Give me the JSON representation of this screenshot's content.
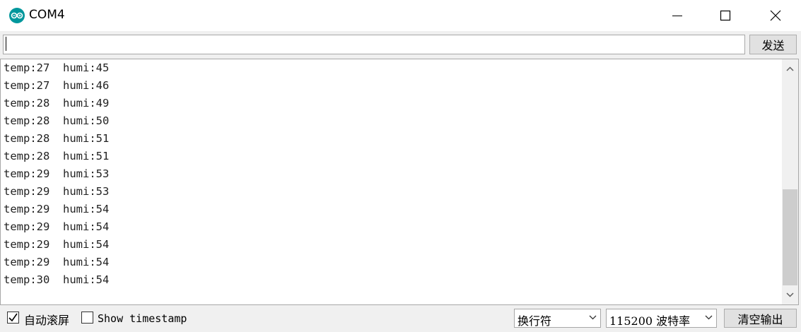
{
  "window": {
    "title": "COM4",
    "controls": {
      "minimize_icon": "minimize-icon",
      "maximize_icon": "maximize-icon",
      "close_icon": "close-icon"
    }
  },
  "send": {
    "input_value": "",
    "button_label": "发送"
  },
  "output": {
    "lines": [
      "temp:27  humi:45",
      "temp:27  humi:46",
      "temp:28  humi:49",
      "temp:28  humi:50",
      "temp:28  humi:51",
      "temp:28  humi:51",
      "temp:29  humi:53",
      "temp:29  humi:53",
      "temp:29  humi:54",
      "temp:29  humi:54",
      "temp:29  humi:54",
      "temp:29  humi:54",
      "temp:30  humi:54"
    ]
  },
  "footer": {
    "autoscroll_label": "自动滚屏",
    "autoscroll_checked": true,
    "timestamp_label": "Show timestamp",
    "timestamp_checked": false,
    "line_ending": "换行符",
    "baud_rate": "115200 波特率",
    "clear_label": "清空输出"
  },
  "colors": {
    "accent": "#00979c"
  }
}
